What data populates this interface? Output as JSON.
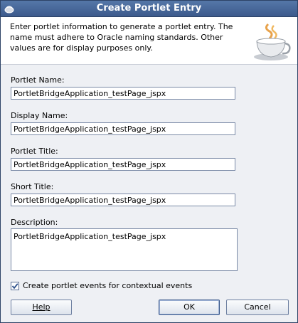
{
  "window": {
    "title": "Create Portlet Entry"
  },
  "header": {
    "description": "Enter portlet information to generate a portlet entry. The name must adhere to Oracle naming standards. Other values are for display purposes only.",
    "icon": "java-cup-icon"
  },
  "form": {
    "portlet_name": {
      "label": "Portlet Name:",
      "value": "PortletBridgeApplication_testPage_jspx"
    },
    "display_name": {
      "label": "Display Name:",
      "value": "PortletBridgeApplication_testPage_jspx"
    },
    "portlet_title": {
      "label": "Portlet Title:",
      "value": "PortletBridgeApplication_testPage_jspx"
    },
    "short_title": {
      "label": "Short Title:",
      "value": "PortletBridgeApplication_testPage_jspx"
    },
    "description": {
      "label": "Description:",
      "value": "PortletBridgeApplication_testPage_jspx"
    },
    "create_events": {
      "label": "Create portlet events for contextual events",
      "checked": true
    }
  },
  "buttons": {
    "help": "Help",
    "ok": "OK",
    "cancel": "Cancel"
  },
  "colors": {
    "titlebar": "#4a6a9c",
    "header_bg": "#ffffff",
    "dialog_bg": "#eef0f4"
  }
}
